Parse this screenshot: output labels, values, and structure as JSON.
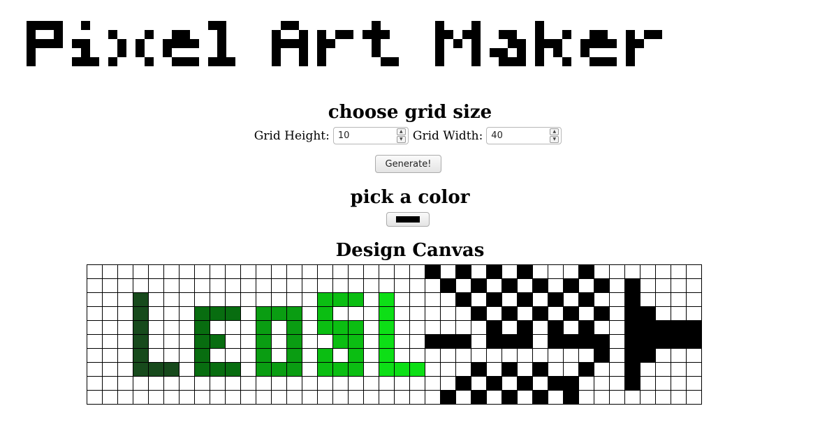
{
  "app": {
    "title": "Pixel Art Maker"
  },
  "grid_size": {
    "heading": "choose grid size",
    "height_label": "Grid Height:",
    "height_value": "10",
    "width_label": "Grid Width:",
    "width_value": "40",
    "generate_label": "Generate!"
  },
  "color_picker": {
    "heading": "pick a color",
    "value": "#000000"
  },
  "canvas": {
    "heading": "Design Canvas",
    "rows": 10,
    "cols": 40,
    "palette": {
      "1": "#174a1c",
      "2": "#086d10",
      "3": "#0a9d12",
      "4": "#0bbe12",
      "5": "#0ddf16",
      "k": "#000000"
    },
    "pixels": [
      "                           k   k k  k  k  k          ",
      "                            k  k k  k  k  k     k    ",
      "    1                4    5   k  kk k  kk k  k k   k  ",
      "    1      2    3    4    5    k  k kk  k  k k   k  ",
      "    1      2    3    4    5    ",
      "    1      2    3    4    5    ",
      "    1      2    3    4    5    ",
      "    1      2    3    4    5    ",
      "    1      2    3    4    5    ",
      "    1      2    3    4    5    "
    ]
  }
}
